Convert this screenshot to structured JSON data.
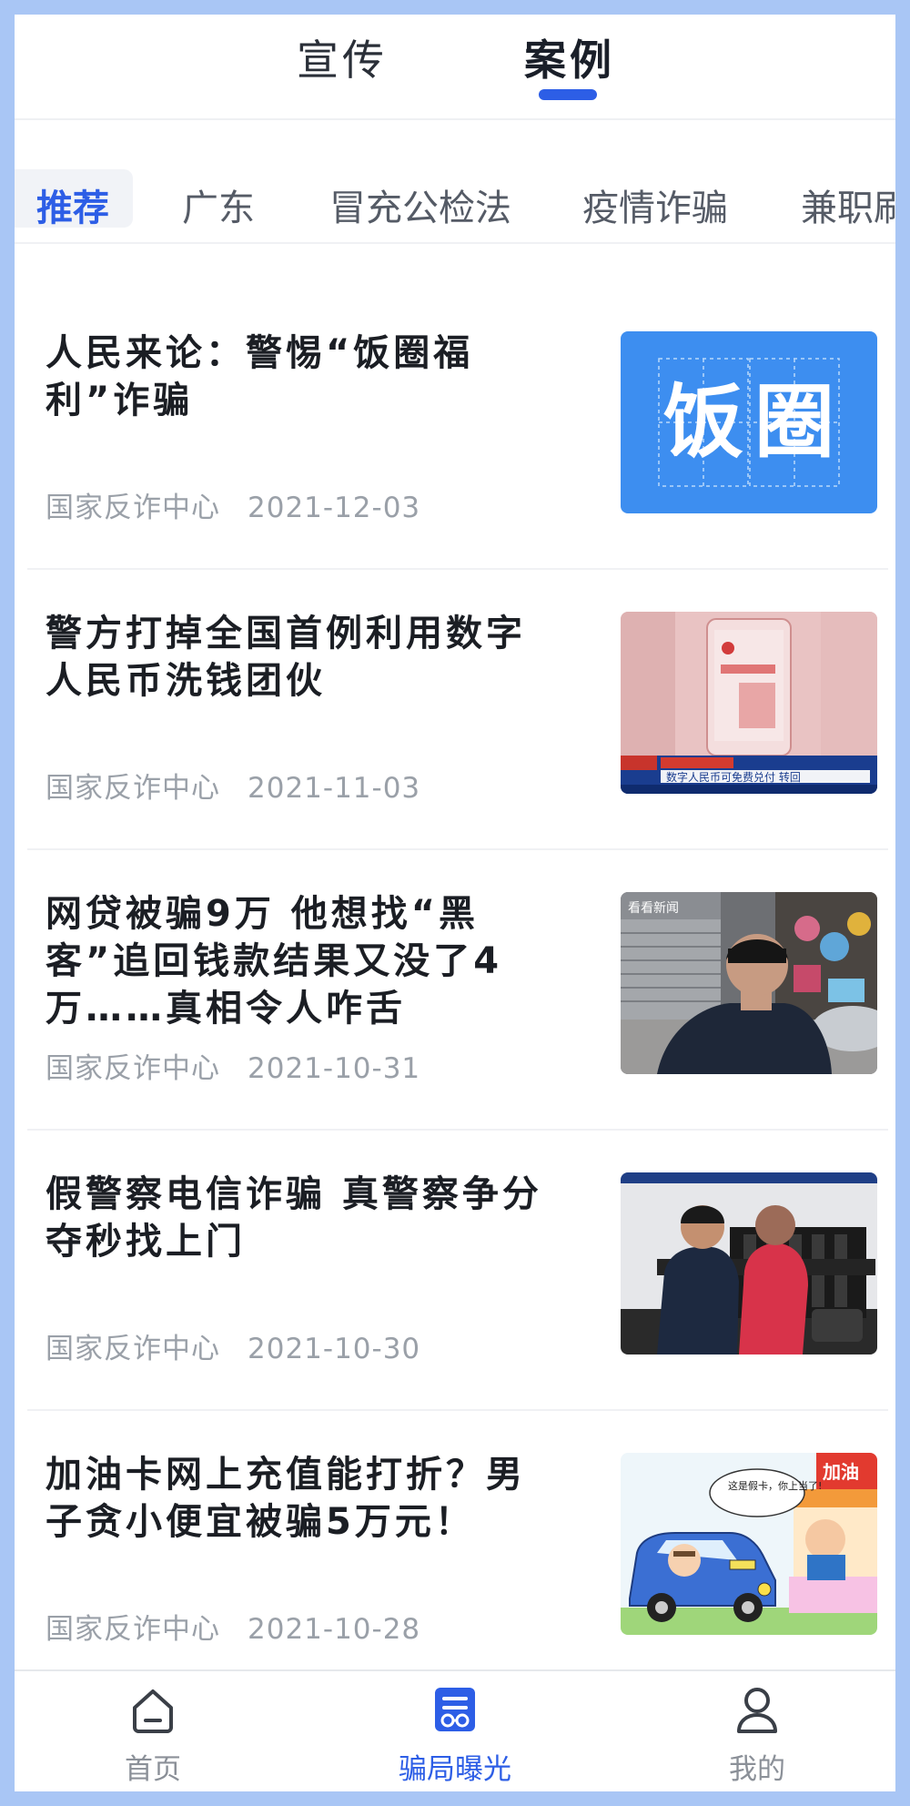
{
  "top_tabs": [
    {
      "label": "宣传",
      "active": false
    },
    {
      "label": "案例",
      "active": true
    }
  ],
  "categories": [
    "推荐",
    "广东",
    "冒充公检法",
    "疫情诈骗",
    "兼职刷"
  ],
  "articles": [
    {
      "title": "人民来论：警惕“饭圈福利”诈骗",
      "source": "国家反诈中心",
      "date": "2021-12-03",
      "thumb_text": [
        "饭",
        "圈"
      ],
      "thumb": "fanquan-graphic"
    },
    {
      "title": "警方打掉全国首例利用数字人民币洗钱团伙",
      "source": "国家反诈中心",
      "date": "2021-11-03",
      "thumb": "digital-rmb-news",
      "thumb_caption": "数字人民币可免费兑付 转回"
    },
    {
      "title": "网贷被骗9万 他想找“黑客”追回钱款结果又没了4万……真相令人咋舌",
      "source": "国家反诈中心",
      "date": "2021-10-31",
      "thumb": "street-man-photo",
      "thumb_watermark": "看看新闻"
    },
    {
      "title": "假警察电信诈骗 真警察争分夺秒找上门",
      "source": "国家反诈中心",
      "date": "2021-10-30",
      "thumb": "police-bench-photo"
    },
    {
      "title": "加油卡网上充值能打折？男子贪小便宜被骗5万元！",
      "source": "国家反诈中心",
      "date": "2021-10-28",
      "thumb": "cartoon-gas-station",
      "thumb_bubble": "这是假卡，你上当了!",
      "thumb_sign": "加油"
    }
  ],
  "bottom_nav": [
    {
      "label": "首页",
      "icon": "home-icon",
      "active": false
    },
    {
      "label": "骗局曝光",
      "icon": "exposure-icon",
      "active": true
    },
    {
      "label": "我的",
      "icon": "profile-icon",
      "active": false
    }
  ],
  "colors": {
    "accent": "#2d5ee6",
    "frame": "#a9c6f5",
    "muted": "#9aa0a8"
  }
}
